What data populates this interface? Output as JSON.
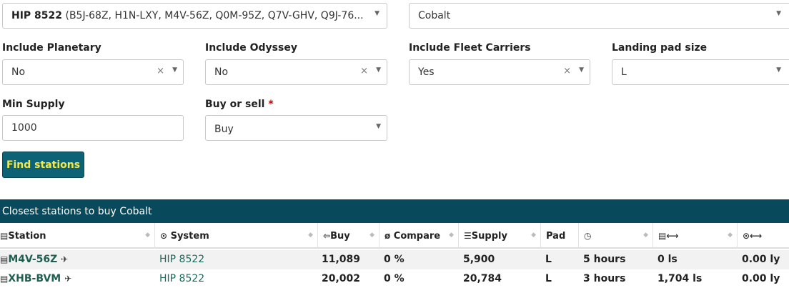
{
  "form": {
    "system_select": {
      "bold": "HIP 8522",
      "rest": " (B5J-68Z, H1N-LXY, M4V-56Z, Q0M-95Z, Q7V-GHV, Q9J-76..."
    },
    "commodity_select": "Cobalt",
    "include_planetary": {
      "label": "Include Planetary",
      "value": "No"
    },
    "include_odyssey": {
      "label": "Include Odyssey",
      "value": "No"
    },
    "include_fleet_carriers": {
      "label": "Include Fleet Carriers",
      "value": "Yes"
    },
    "landing_pad_size": {
      "label": "Landing pad size",
      "value": "L"
    },
    "min_supply": {
      "label": "Min Supply",
      "value": "1000"
    },
    "buy_or_sell": {
      "label": "Buy or sell",
      "required_mark": "*",
      "value": "Buy"
    },
    "find_button": "Find stations"
  },
  "icons": {
    "clear": "×",
    "dropdown": "▼",
    "sort": "◆"
  },
  "results": {
    "title": "Closest stations to buy Cobalt",
    "columns": {
      "station": "Station",
      "system": "System",
      "buy": "Buy",
      "compare": "Compare",
      "supply": "Supply",
      "pad": "Pad"
    },
    "rows": [
      {
        "station": "M4V-56Z",
        "system": "HIP 8522",
        "buy": "11,089",
        "compare": "0 %",
        "supply": "5,900",
        "pad": "L",
        "updated": "5 hours",
        "arrival": "0 ls",
        "distance": "0.00 ly"
      },
      {
        "station": "XHB-BVM",
        "system": "HIP 8522",
        "buy": "20,002",
        "compare": "0 %",
        "supply": "20,784",
        "pad": "L",
        "updated": "3 hours",
        "arrival": "1,704 ls",
        "distance": "0.00 ly"
      }
    ]
  },
  "colors": {
    "accent": "#084a5c",
    "button_bg": "#0e6276",
    "button_text": "#f5e94a",
    "link": "#1b6b5a"
  }
}
